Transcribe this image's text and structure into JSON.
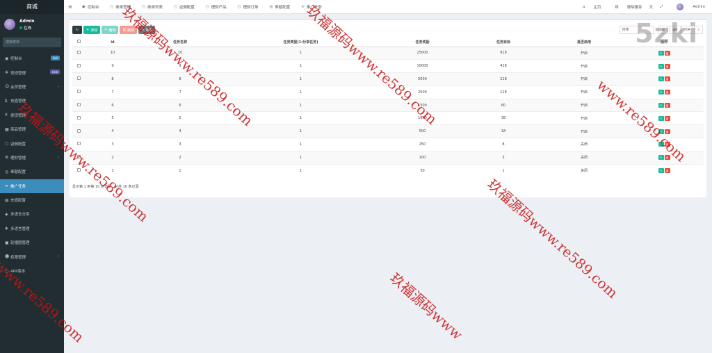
{
  "sidebar": {
    "brand": "商城",
    "user": {
      "name": "Admin",
      "status": "在线"
    },
    "search_placeholder": "搜索菜单",
    "items": [
      {
        "label": "控制台",
        "icon": "dashboard-icon",
        "glyph": "◉",
        "badge": "hot"
      },
      {
        "label": "常规管理",
        "icon": "cogs-icon",
        "glyph": "✲",
        "badge": "new"
      },
      {
        "label": "会员管理",
        "icon": "user-icon",
        "glyph": "☺",
        "chevron": "‹"
      },
      {
        "label": "充值管理",
        "icon": "coin-icon",
        "glyph": "$"
      },
      {
        "label": "提现管理",
        "icon": "yen-icon",
        "glyph": "¥"
      },
      {
        "label": "商品管理",
        "icon": "store-icon",
        "glyph": "▦"
      },
      {
        "label": "返佣配置",
        "icon": "circle-icon",
        "glyph": "○"
      },
      {
        "label": "理财管理",
        "icon": "list-icon",
        "glyph": "≣",
        "chevron": "‹"
      },
      {
        "label": "奉献配置",
        "icon": "gear-circle-icon",
        "glyph": "◎"
      },
      {
        "label": "推广任务",
        "icon": "link-icon",
        "glyph": "∞",
        "active": true
      },
      {
        "label": "充值配置",
        "icon": "grid-icon",
        "glyph": "▤"
      },
      {
        "label": "多语言分类",
        "icon": "tag-icon",
        "glyph": "◈"
      },
      {
        "label": "多语言管理",
        "icon": "language-icon",
        "glyph": "◈"
      },
      {
        "label": "轮播图管理",
        "icon": "image-icon",
        "glyph": "▣"
      },
      {
        "label": "权限管理",
        "icon": "group-icon",
        "glyph": "☻",
        "chevron": "‹"
      },
      {
        "label": "APP版本",
        "icon": "circle-icon",
        "glyph": "○"
      }
    ]
  },
  "topnav": {
    "tabs": [
      {
        "label": "控制台",
        "glyph": "◉",
        "icon": "dashboard-icon"
      },
      {
        "label": "商单管理",
        "glyph": "○",
        "icon": "circle-icon"
      },
      {
        "label": "商单列表",
        "glyph": "○",
        "icon": "circle-icon"
      },
      {
        "label": "返佣配置",
        "glyph": "○",
        "icon": "circle-icon"
      },
      {
        "label": "理财产品",
        "glyph": "○",
        "icon": "circle-icon"
      },
      {
        "label": "理财订单",
        "glyph": "○",
        "icon": "circle-icon"
      },
      {
        "label": "奉献配置",
        "glyph": "◎",
        "icon": "gear-circle-icon"
      },
      {
        "label": "推广任务",
        "glyph": "∞",
        "icon": "link-icon"
      }
    ],
    "right": {
      "home": "主页",
      "clear_cache": "清除缓存",
      "user": "Admin"
    }
  },
  "toolbar": {
    "add": "添加",
    "edit": "编辑",
    "delete": "删除",
    "more": "更多",
    "search_placeholder": "搜索"
  },
  "table": {
    "headers": [
      "id",
      "任务名称",
      "任务类型(1:分享任务)",
      "任务奖励",
      "任务目标",
      "是否启用",
      "操作"
    ],
    "rows": [
      {
        "id": "10",
        "name": "10",
        "type": "1",
        "reward": "25000",
        "target": "918",
        "enabled": "开启"
      },
      {
        "id": "9",
        "name": "9",
        "type": "1",
        "reward": "10000",
        "target": "418",
        "enabled": "开启"
      },
      {
        "id": "8",
        "name": "8",
        "type": "1",
        "reward": "5000",
        "target": "218",
        "enabled": "开启"
      },
      {
        "id": "7",
        "name": "7",
        "type": "1",
        "reward": "2500",
        "target": "118",
        "enabled": "开启"
      },
      {
        "id": "6",
        "name": "6",
        "type": "1",
        "reward": "1500",
        "target": "60",
        "enabled": "开启"
      },
      {
        "id": "5",
        "name": "5",
        "type": "1",
        "reward": "1000",
        "target": "38",
        "enabled": "开启"
      },
      {
        "id": "4",
        "name": "4",
        "type": "1",
        "reward": "500",
        "target": "18",
        "enabled": "开启"
      },
      {
        "id": "3",
        "name": "3",
        "type": "1",
        "reward": "250",
        "target": "8",
        "enabled": "关闭"
      },
      {
        "id": "2",
        "name": "2",
        "type": "1",
        "reward": "100",
        "target": "3",
        "enabled": "关闭"
      },
      {
        "id": "1",
        "name": "1",
        "type": "1",
        "reward": "50",
        "target": "1",
        "enabled": "关闭"
      }
    ],
    "footer": "显示第 1 到第 10 条记录，总共 10 条记录"
  },
  "logo": "5zki",
  "watermarks": [
    "玖福源码www.re589.com",
    "www.re589.com",
    "玖福源码www.re589.com",
    "玖福源码www.re589.com",
    "www.re589.com",
    "玖福源码www.re589.com",
    "玖福源码www"
  ],
  "colors": {
    "sidebar_bg": "#222d32",
    "active": "#3c8dbc",
    "add_btn": "#18bc9c",
    "delete_btn": "#e74c3c",
    "watermark": "#c81414"
  }
}
